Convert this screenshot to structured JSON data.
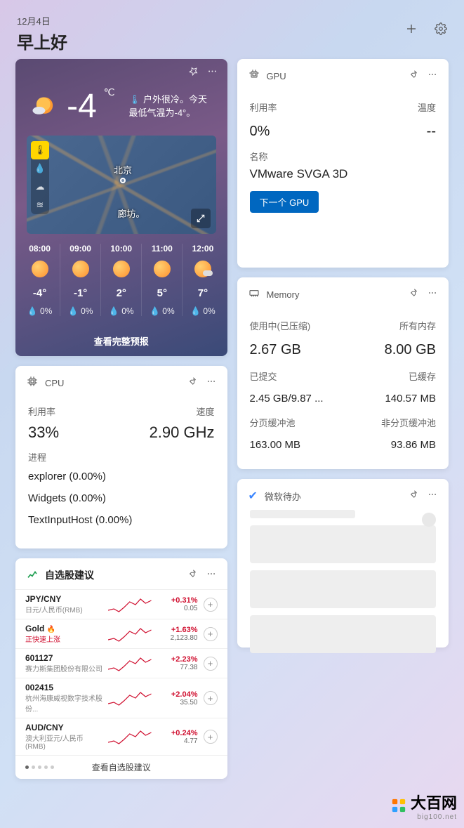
{
  "header": {
    "date": "12月4日",
    "greeting": "早上好"
  },
  "weather": {
    "temp": "-4",
    "unit": "℃",
    "desc": "户外很冷。今天最低气温为-4°。",
    "city1": "北京",
    "city2": "廊坊。",
    "hours": [
      {
        "time": "08:00",
        "temp": "-4°",
        "hum": "0%",
        "icon": "sun"
      },
      {
        "time": "09:00",
        "temp": "-1°",
        "hum": "0%",
        "icon": "sun"
      },
      {
        "time": "10:00",
        "temp": "2°",
        "hum": "0%",
        "icon": "sun"
      },
      {
        "time": "11:00",
        "temp": "5°",
        "hum": "0%",
        "icon": "sun"
      },
      {
        "time": "12:00",
        "temp": "7°",
        "hum": "0%",
        "icon": "suncloud"
      }
    ],
    "link": "查看完整预报"
  },
  "cpu": {
    "title": "CPU",
    "util_label": "利用率",
    "speed_label": "速度",
    "util": "33%",
    "speed": "2.90 GHz",
    "proc_label": "进程",
    "procs": [
      "explorer (0.00%)",
      "Widgets (0.00%)",
      "TextInputHost (0.00%)"
    ]
  },
  "stocks": {
    "title": "自选股建议",
    "link": "查看自选股建议",
    "rows": [
      {
        "name": "JPY/CNY",
        "sub": "日元/人民币(RMB)",
        "pct": "+0.31%",
        "price": "0.05",
        "rising": false
      },
      {
        "name": "Gold",
        "sub": "正快速上涨",
        "pct": "+1.63%",
        "price": "2,123.80",
        "rising": true,
        "fire": true
      },
      {
        "name": "601127",
        "sub": "赛力斯集团股份有限公司",
        "pct": "+2.23%",
        "price": "77.38",
        "rising": false
      },
      {
        "name": "002415",
        "sub": "杭州海康威视数字技术股份...",
        "pct": "+2.04%",
        "price": "35.50",
        "rising": false
      },
      {
        "name": "AUD/CNY",
        "sub": "澳大利亚元/人民币(RMB)",
        "pct": "+0.24%",
        "price": "4.77",
        "rising": false
      }
    ]
  },
  "gpu": {
    "title": "GPU",
    "util_label": "利用率",
    "temp_label": "温度",
    "util": "0%",
    "temp": "--",
    "name_label": "名称",
    "name": "VMware SVGA 3D",
    "button": "下一个 GPU"
  },
  "memory": {
    "title": "Memory",
    "used_label": "使用中(已压缩)",
    "total_label": "所有内存",
    "used": "2.67 GB",
    "total": "8.00 GB",
    "commit_label": "已提交",
    "cached_label": "已缓存",
    "commit": "2.45 GB/9.87 ...",
    "cached": "140.57 MB",
    "paged_label": "分页缓冲池",
    "nonpaged_label": "非分页缓冲池",
    "paged": "163.00 MB",
    "nonpaged": "93.86 MB"
  },
  "todo": {
    "title": "微软待办"
  },
  "watermark": {
    "main": "大百网",
    "sub": "big100.net"
  }
}
